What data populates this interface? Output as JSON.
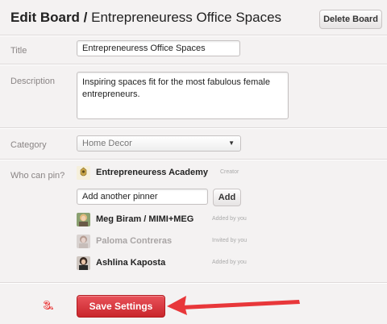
{
  "header": {
    "title_prefix": "Edit Board",
    "title_separator": " / ",
    "board_name": "Entrepreneuress Office Spaces",
    "delete_label": "Delete Board"
  },
  "form": {
    "title_label": "Title",
    "title_value": "Entrepreneuress Office Spaces",
    "description_label": "Description",
    "description_value": "Inspiring spaces fit for the most fabulous female entrepreneurs.",
    "category_label": "Category",
    "category_value": "Home Decor",
    "who_label": "Who can pin?"
  },
  "owner": {
    "name": "Entrepreneuress Academy",
    "role": "Creator"
  },
  "add_pinner": {
    "placeholder": "Add another pinner",
    "button_label": "Add"
  },
  "pinners": [
    {
      "name": "Meg Biram / MIMI+MEG",
      "status": "Added by you"
    },
    {
      "name": "Paloma Contreras",
      "status": "Invited by you"
    },
    {
      "name": "Ashlina Kaposta",
      "status": "Added by you"
    }
  ],
  "footer": {
    "step_label": "3.",
    "save_label": "Save Settings"
  },
  "colors": {
    "save_button": "#d9343a",
    "arrow": "#e8373a",
    "background": "#f4f2f2"
  }
}
